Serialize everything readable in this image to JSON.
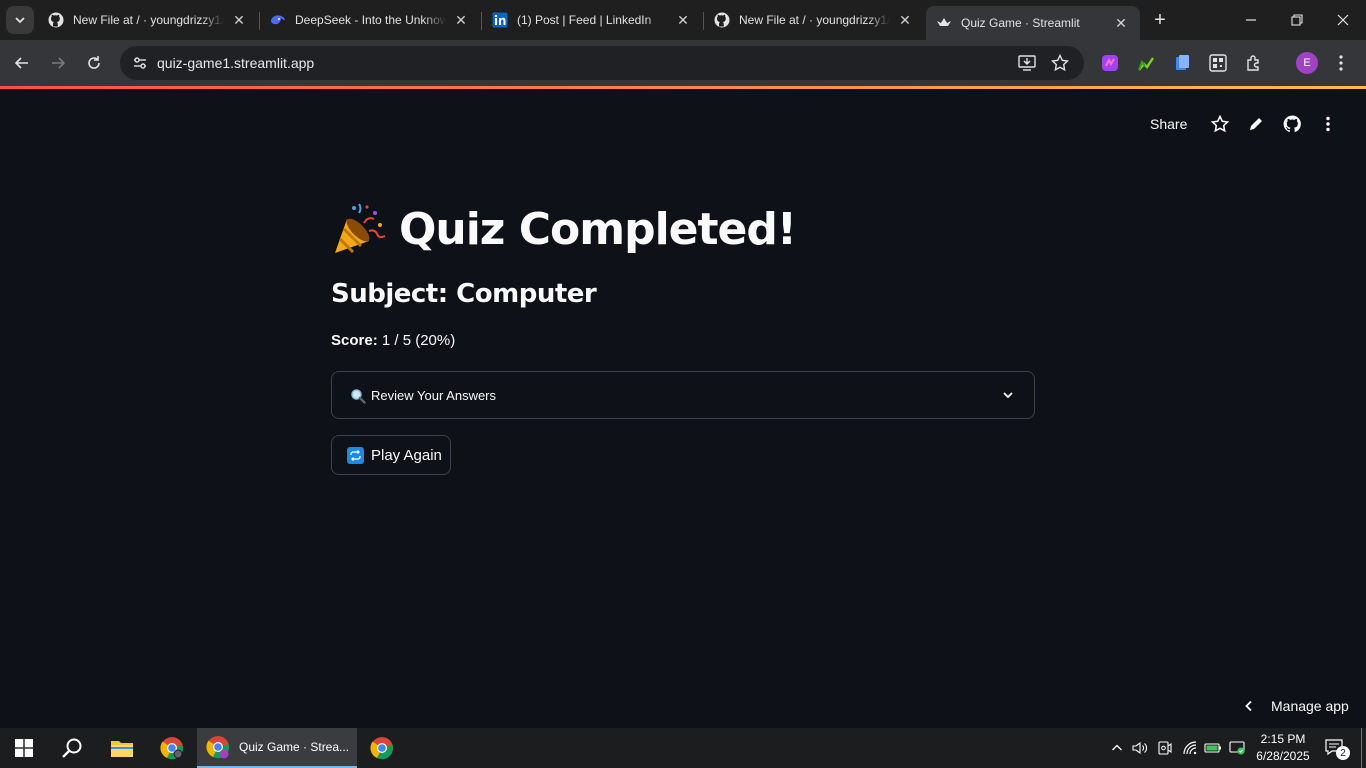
{
  "browser": {
    "tabs": [
      {
        "title": "New File at / · youngdrizzy1/",
        "icon": "github-icon",
        "active": false
      },
      {
        "title": "DeepSeek - Into the Unknown",
        "icon": "deepseek-icon",
        "active": false
      },
      {
        "title": "(1) Post | Feed | LinkedIn",
        "icon": "linkedin-icon",
        "active": false
      },
      {
        "title": "New File at / · youngdrizzy1/",
        "icon": "github-icon",
        "active": false
      },
      {
        "title": "Quiz Game · Streamlit",
        "icon": "streamlit-icon",
        "active": true
      }
    ],
    "url": "quiz-game1.streamlit.app",
    "profile_initial": "E",
    "accent": "#ff4b4b"
  },
  "app": {
    "header": {
      "share_label": "Share"
    },
    "title_emoji": "party-popper-icon",
    "title": "Quiz Completed!",
    "subject": "Subject: Computer",
    "score_label": "Score:",
    "score_value": " 1 / 5 (20%)",
    "score_fraction": 0.2,
    "expander": {
      "icon": "magnifier-icon",
      "label": "Review Your Answers",
      "expanded": false
    },
    "play_again": {
      "icon": "repeat-icon",
      "label": "Play Again"
    },
    "manage_app_label": "Manage app"
  },
  "taskbar": {
    "active_window_label": "Quiz Game · Strea...",
    "clock_time": "2:15 PM",
    "clock_date": "6/28/2025",
    "notification_count": "2"
  }
}
